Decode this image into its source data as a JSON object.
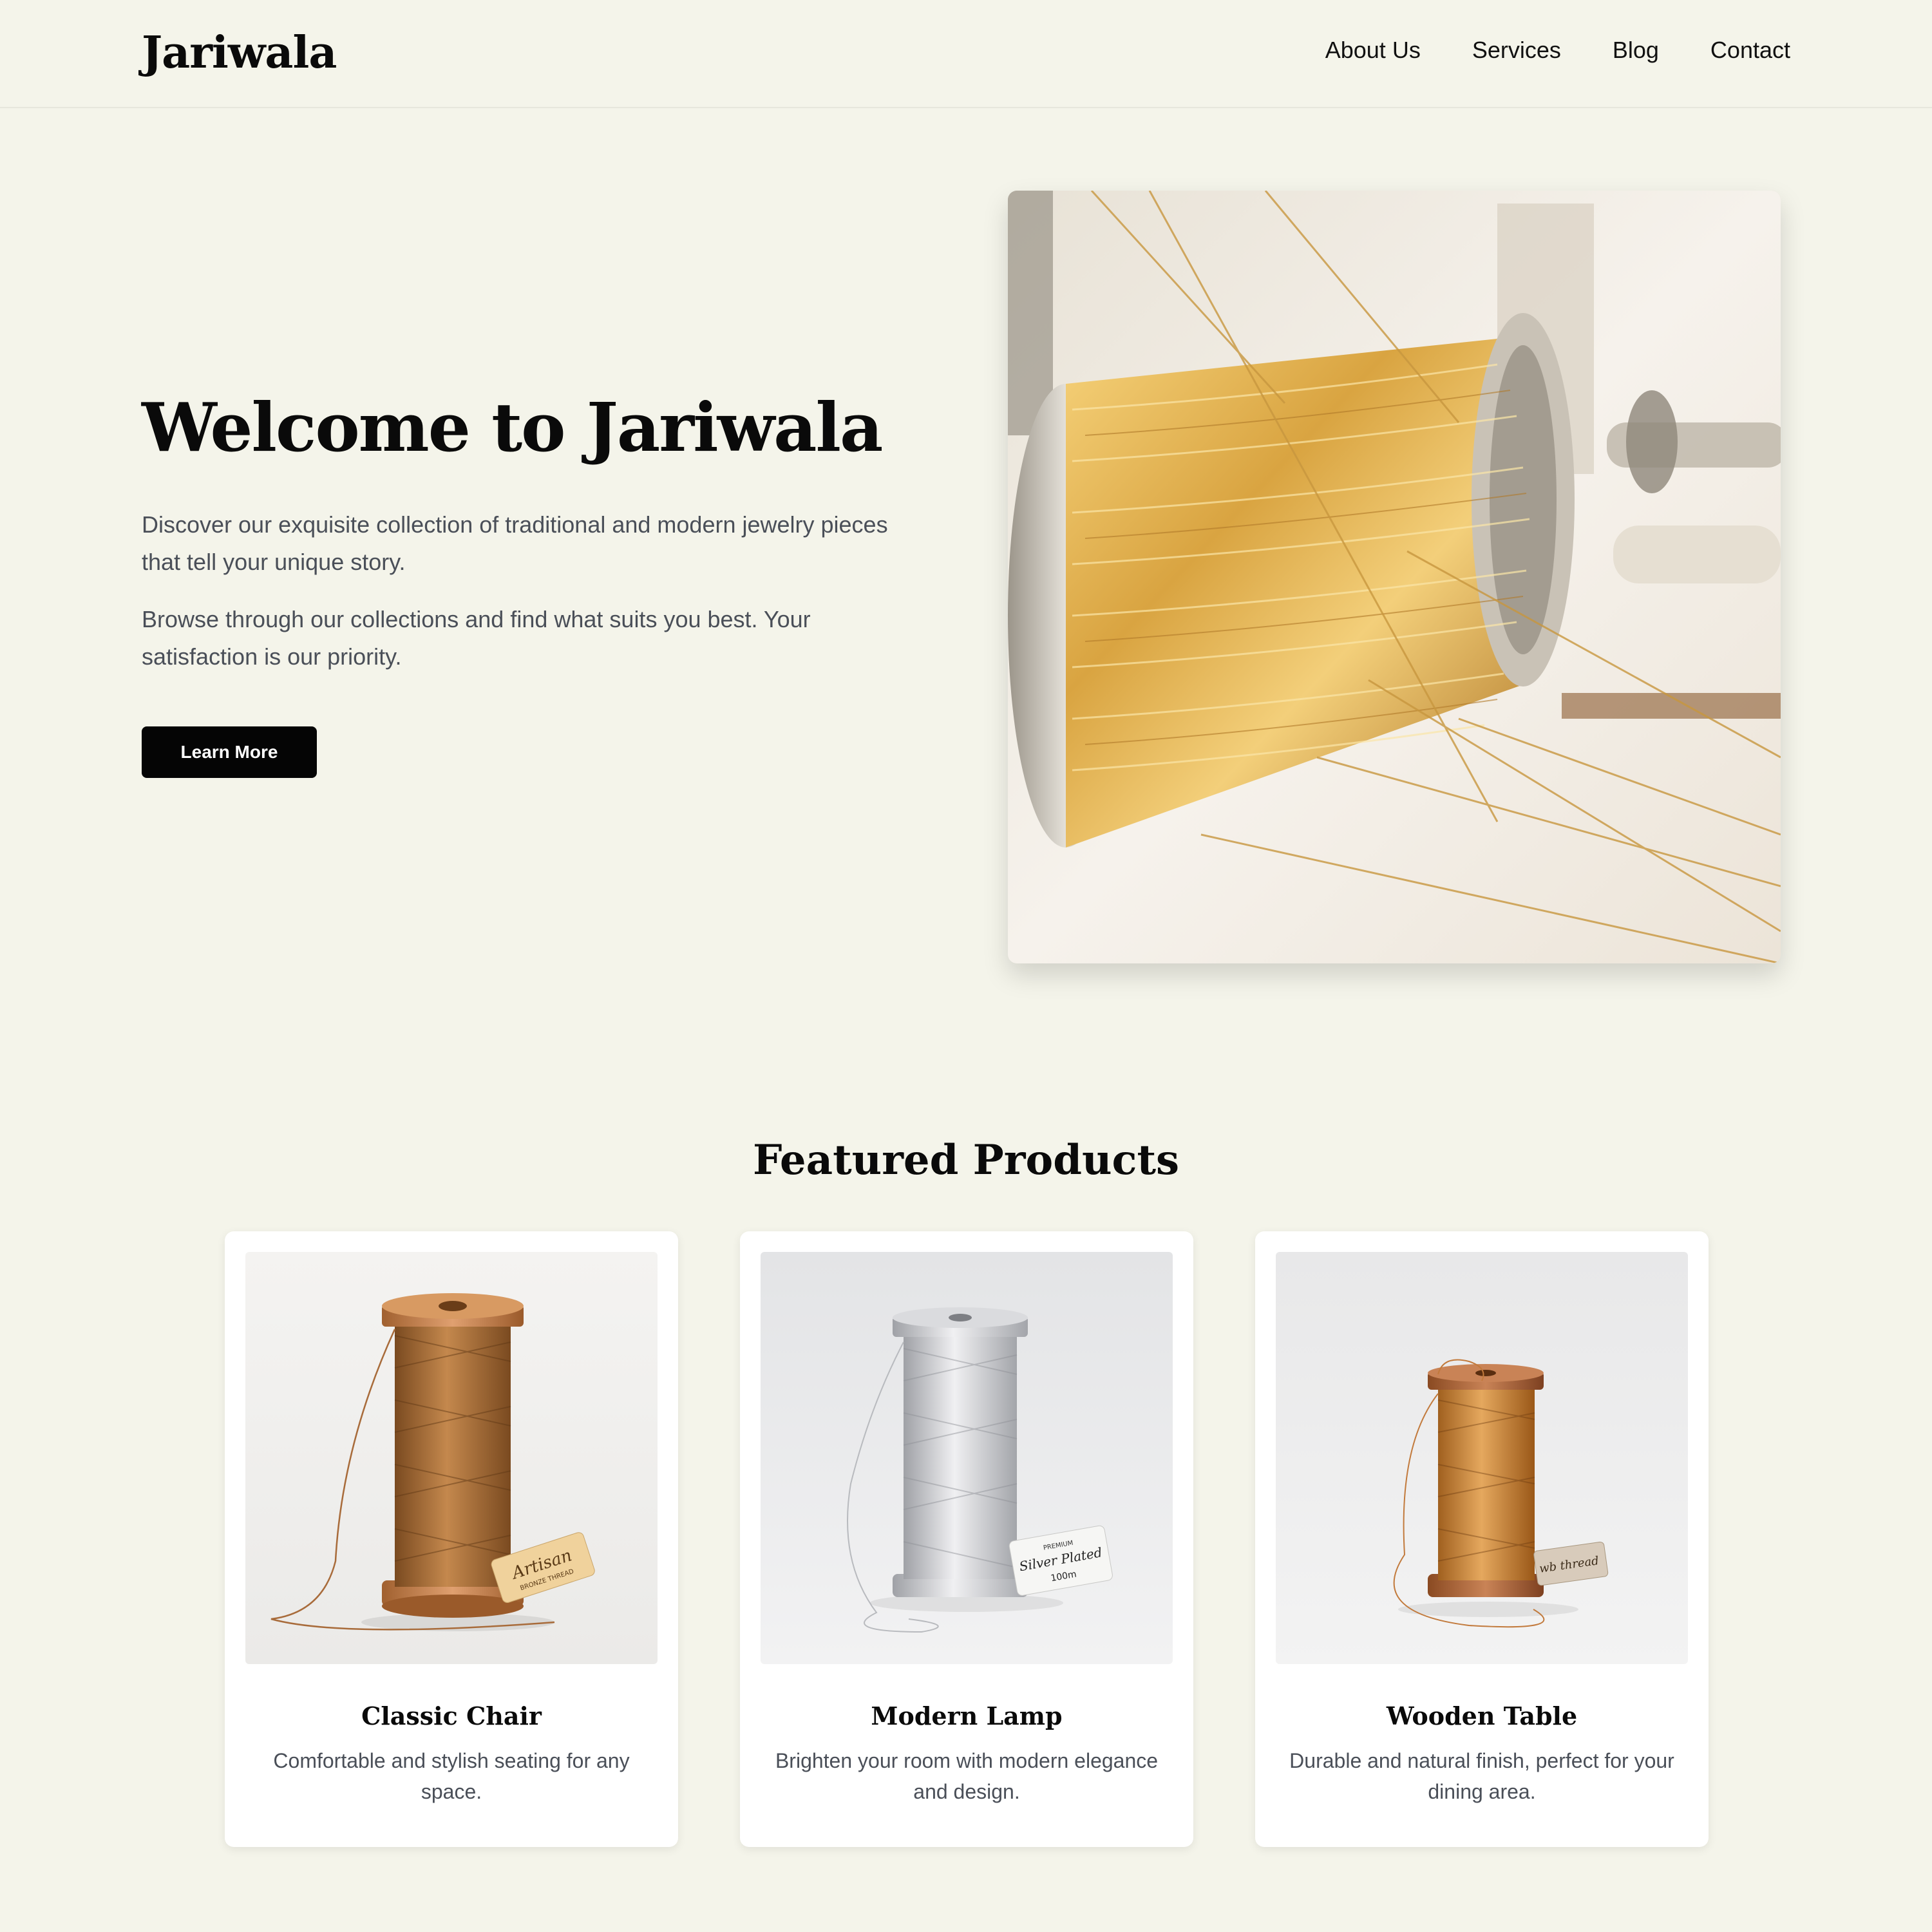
{
  "brand": {
    "name": "Jariwala"
  },
  "nav": {
    "items": [
      {
        "label": "About Us"
      },
      {
        "label": "Services"
      },
      {
        "label": "Blog"
      },
      {
        "label": "Contact"
      }
    ]
  },
  "hero": {
    "title": "Welcome to Jariwala",
    "paragraph1": "Discover our exquisite collection of traditional and modern jewelry pieces that tell your unique story.",
    "paragraph2": "Browse through our collections and find what suits you best. Your satisfaction is our priority.",
    "button_label": "Learn More"
  },
  "featured": {
    "title": "Featured Products",
    "products": [
      {
        "name": "Classic Chair",
        "description": "Comfortable and stylish seating for any space.",
        "tag_text": "Artisan",
        "tag_subtext": "BRONZE THREAD"
      },
      {
        "name": "Modern Lamp",
        "description": "Brighten your room with modern elegance and design.",
        "tag_text": "Silver Plated",
        "tag_subtext": "PREMIUM",
        "tag_detail": "100m"
      },
      {
        "name": "Wooden Table",
        "description": "Durable and natural finish, perfect for your dining area.",
        "tag_text": "wb thread",
        "tag_subtext": ""
      }
    ]
  },
  "colors": {
    "background": "#f4f4ea",
    "button": "#050505",
    "body_text": "#4a4f58",
    "gold_thread": "#d9a441",
    "bronze_thread": "#a86b3a",
    "silver_thread": "#c8c9cc",
    "copper_thread": "#c27a3c"
  }
}
